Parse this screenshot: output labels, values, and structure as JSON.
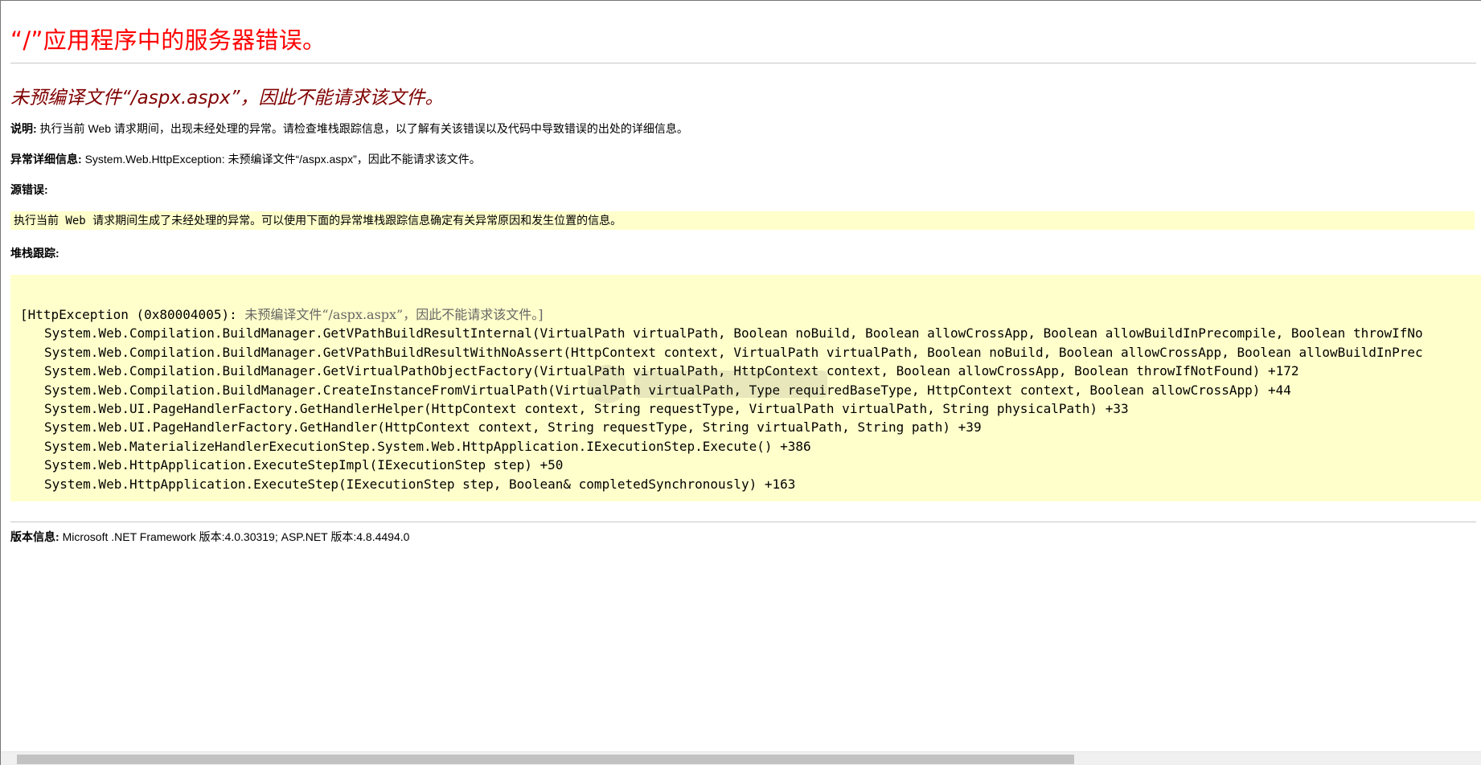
{
  "error": {
    "title": "“/”应用程序中的服务器错误。",
    "subtitle": "未预编译文件“/aspx.aspx”，因此不能请求该文件。",
    "description_label": "说明:",
    "description_text": "执行当前 Web 请求期间，出现未经处理的异常。请检查堆栈跟踪信息，以了解有关该错误以及代码中导致错误的出处的详细信息。",
    "details_label": "异常详细信息:",
    "details_text": "System.Web.HttpException: 未预编译文件“/aspx.aspx”，因此不能请求该文件。",
    "source_label": "源错误:",
    "source_text": "执行当前 Web 请求期间生成了未经处理的异常。可以使用下面的异常堆栈跟踪信息确定有关异常原因和发生位置的信息。",
    "stack_label": "堆栈跟踪:",
    "stack_head_prefix": "[HttpException (0x80004005): ",
    "stack_head_message": "未预编译文件“/aspx.aspx”，因此不能请求该文件。",
    "stack_head_suffix": "]",
    "stack_lines": [
      "System.Web.Compilation.BuildManager.GetVPathBuildResultInternal(VirtualPath virtualPath, Boolean noBuild, Boolean allowCrossApp, Boolean allowBuildInPrecompile, Boolean throwIfNo",
      "System.Web.Compilation.BuildManager.GetVPathBuildResultWithNoAssert(HttpContext context, VirtualPath virtualPath, Boolean noBuild, Boolean allowCrossApp, Boolean allowBuildInPrec",
      "System.Web.Compilation.BuildManager.GetVirtualPathObjectFactory(VirtualPath virtualPath, HttpContext context, Boolean allowCrossApp, Boolean throwIfNotFound) +172",
      "System.Web.Compilation.BuildManager.CreateInstanceFromVirtualPath(VirtualPath virtualPath, Type requiredBaseType, HttpContext context, Boolean allowCrossApp) +44",
      "System.Web.UI.PageHandlerFactory.GetHandlerHelper(HttpContext context, String requestType, VirtualPath virtualPath, String physicalPath) +33",
      "System.Web.UI.PageHandlerFactory.GetHandler(HttpContext context, String requestType, String virtualPath, String path) +39",
      "System.Web.MaterializeHandlerExecutionStep.System.Web.HttpApplication.IExecutionStep.Execute() +386",
      "System.Web.HttpApplication.ExecuteStepImpl(IExecutionStep step) +50",
      "System.Web.HttpApplication.ExecuteStep(IExecutionStep step, Boolean& completedSynchronously) +163"
    ],
    "version_label": "版本信息:",
    "version_text": "Microsoft .NET Framework 版本:4.0.30319; ASP.NET 版本:4.8.4494.0"
  },
  "colors": {
    "title": "#ff0000",
    "subtitle": "#800000",
    "code_background": "#ffffcc",
    "rule": "#c8c8c8"
  },
  "scrollbar": {
    "position_fraction": 0.0,
    "visible_fraction": 0.73
  }
}
